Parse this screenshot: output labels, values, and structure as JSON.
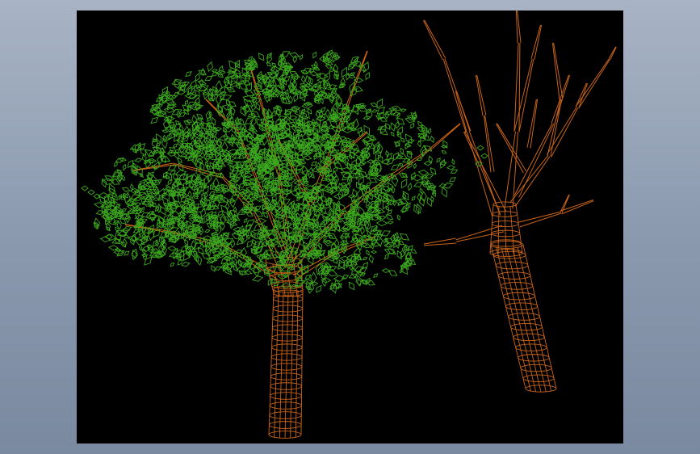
{
  "viewport": {
    "background": "#000000",
    "page_background": "#8c9ab0",
    "trunk_color": "#c8641a",
    "leaf_color": "#3ca81e"
  },
  "scene": {
    "objects": [
      {
        "name": "leafy-tree",
        "trunk_color": "#c8641a",
        "leaf_color": "#3ca81e"
      },
      {
        "name": "bare-tree",
        "trunk_color": "#c8641a"
      }
    ]
  }
}
